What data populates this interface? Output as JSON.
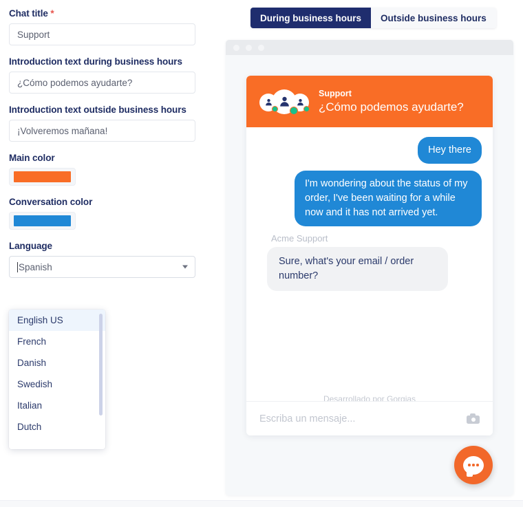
{
  "form": {
    "chat_title": {
      "label": "Chat title",
      "required_marker": "*",
      "value": "Support"
    },
    "intro_during": {
      "label": "Introduction text during business hours",
      "value": "¿Cómo podemos ayudarte?"
    },
    "intro_outside": {
      "label": "Introduction text outside business hours",
      "value": "¡Volveremos mañana!"
    },
    "main_color": {
      "label": "Main color",
      "value": "#f96d26"
    },
    "conversation_color": {
      "label": "Conversation color",
      "value": "#2088d6"
    },
    "language": {
      "label": "Language",
      "value": "Spanish",
      "options": [
        "English US",
        "French",
        "Danish",
        "Swedish",
        "Italian",
        "Dutch"
      ],
      "highlighted_option": "English US"
    }
  },
  "tabs": [
    {
      "label": "During business hours",
      "active": true
    },
    {
      "label": "Outside business hours",
      "active": false
    }
  ],
  "preview": {
    "header": {
      "title": "Support",
      "subtitle": "¿Cómo podemos ayudarte?"
    },
    "messages": [
      {
        "side": "right",
        "type": "visitor",
        "text": "Hey there"
      },
      {
        "side": "right",
        "type": "visitor",
        "text": "I'm wondering about the status of my order, I've been waiting for a while now and it has not arrived yet."
      }
    ],
    "agent_name": "Acme Support",
    "agent_message": "Sure, what's your email / order number?",
    "powered_by": "Desarrollado por Gorgias",
    "input_placeholder": "Escriba un mensaje...",
    "camera_icon": "camera-icon",
    "fab_icon": "chat-bubble-icon"
  }
}
